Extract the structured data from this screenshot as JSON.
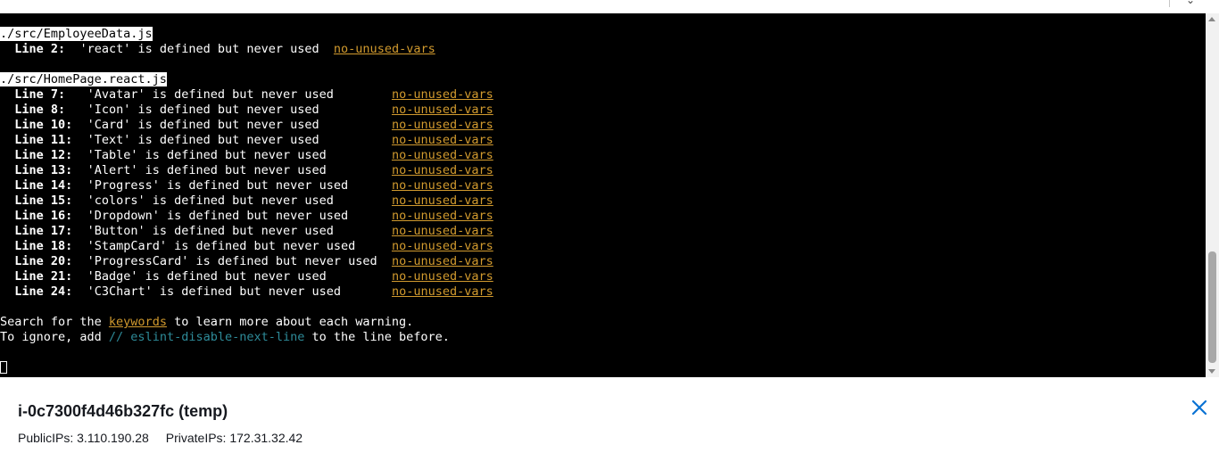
{
  "terminal": {
    "file1": {
      "path": "./src/EmployeeData.js",
      "warnings": [
        {
          "line": "Line 2:",
          "message": "'react' is defined but never used",
          "rule": "no-unused-vars"
        }
      ]
    },
    "file2": {
      "path": "./src/HomePage.react.js",
      "warnings": [
        {
          "line": "Line 7:",
          "message": "'Avatar' is defined but never used",
          "rule": "no-unused-vars"
        },
        {
          "line": "Line 8:",
          "message": "'Icon' is defined but never used",
          "rule": "no-unused-vars"
        },
        {
          "line": "Line 10:",
          "message": "'Card' is defined but never used",
          "rule": "no-unused-vars"
        },
        {
          "line": "Line 11:",
          "message": "'Text' is defined but never used",
          "rule": "no-unused-vars"
        },
        {
          "line": "Line 12:",
          "message": "'Table' is defined but never used",
          "rule": "no-unused-vars"
        },
        {
          "line": "Line 13:",
          "message": "'Alert' is defined but never used",
          "rule": "no-unused-vars"
        },
        {
          "line": "Line 14:",
          "message": "'Progress' is defined but never used",
          "rule": "no-unused-vars"
        },
        {
          "line": "Line 15:",
          "message": "'colors' is defined but never used",
          "rule": "no-unused-vars"
        },
        {
          "line": "Line 16:",
          "message": "'Dropdown' is defined but never used",
          "rule": "no-unused-vars"
        },
        {
          "line": "Line 17:",
          "message": "'Button' is defined but never used",
          "rule": "no-unused-vars"
        },
        {
          "line": "Line 18:",
          "message": "'StampCard' is defined but never used",
          "rule": "no-unused-vars"
        },
        {
          "line": "Line 20:",
          "message": "'ProgressCard' is defined but never used",
          "rule": "no-unused-vars"
        },
        {
          "line": "Line 21:",
          "message": "'Badge' is defined but never used",
          "rule": "no-unused-vars"
        },
        {
          "line": "Line 24:",
          "message": "'C3Chart' is defined but never used",
          "rule": "no-unused-vars"
        }
      ]
    },
    "footer": {
      "search_prefix": "Search for the ",
      "search_keyword": "keywords",
      "search_suffix": " to learn more about each warning.",
      "ignore_prefix": "To ignore, add ",
      "ignore_comment": "// eslint-disable-next-line",
      "ignore_suffix": " to the line before."
    }
  },
  "instance": {
    "title": "i-0c7300f4d46b327fc (temp)",
    "public_ip_label": "PublicIPs:",
    "public_ip": "3.110.190.28",
    "private_ip_label": "PrivateIPs:",
    "private_ip": "172.31.32.42"
  },
  "icons": {
    "close": "close-icon",
    "chevron": "chevron-down-icon"
  },
  "colors": {
    "terminal_bg": "#000000",
    "rule": "#d19a2e",
    "comment": "#2e8b99",
    "close": "#0972d3"
  }
}
